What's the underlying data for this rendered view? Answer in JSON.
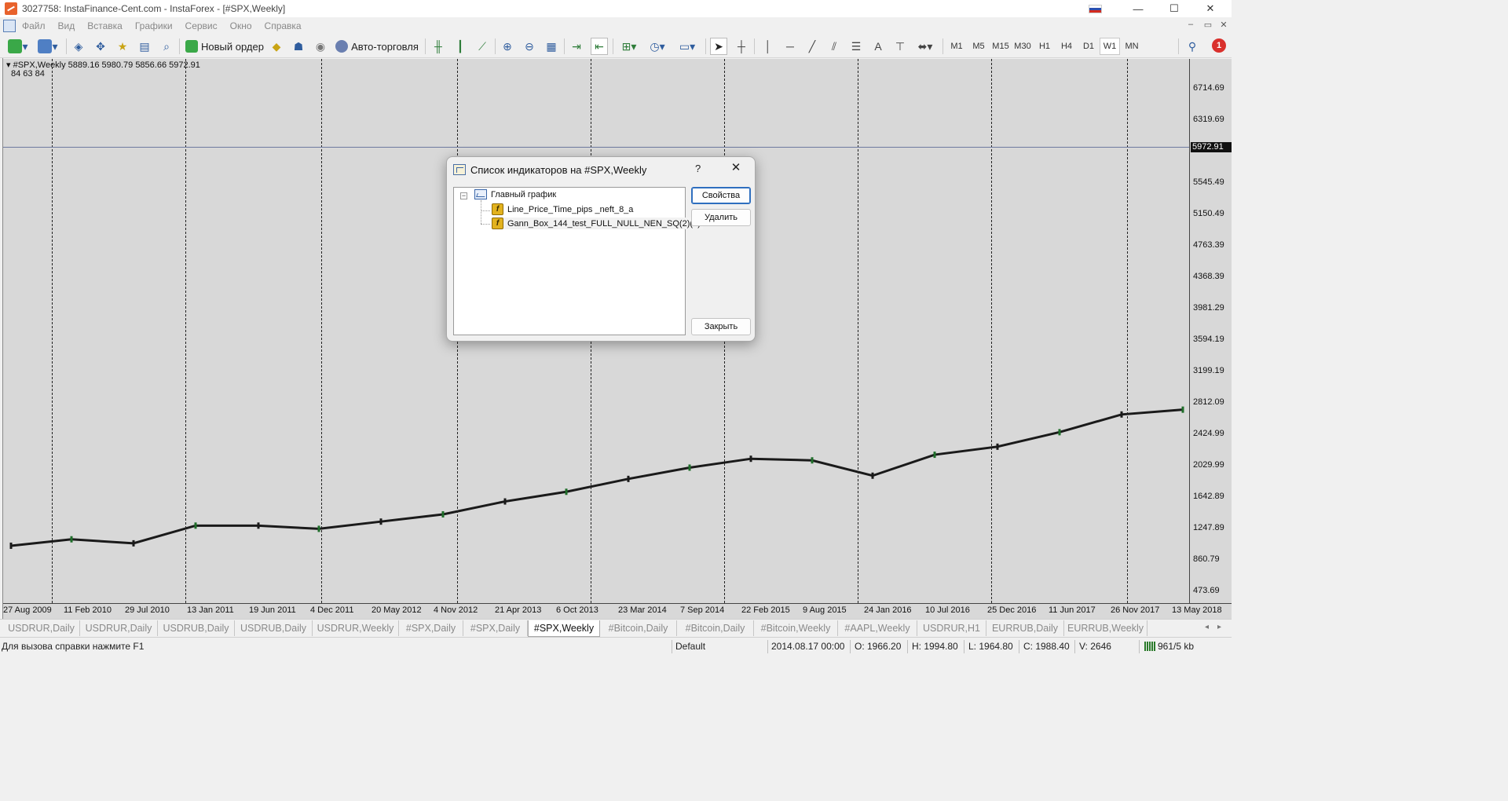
{
  "window": {
    "title": "3027758: InstaFinance-Cent.com - InstaForex - [#SPX,Weekly]",
    "minimize_icon": "—",
    "maximize_icon": "☐",
    "close_icon": "✕"
  },
  "menu": [
    "Файл",
    "Вид",
    "Вставка",
    "Графики",
    "Сервис",
    "Окно",
    "Справка"
  ],
  "toolbar": {
    "new_order_label": "Новый ордер",
    "auto_trading_label": "Авто-торговля",
    "timeframes": [
      "M1",
      "M5",
      "M15",
      "M30",
      "H1",
      "H4",
      "D1",
      "W1",
      "MN"
    ],
    "active_timeframe": "W1",
    "notification_count": "1"
  },
  "chart": {
    "info_line": "#SPX,Weekly  5889.16 5980.79 5856.66 5972.91",
    "info_values": "84   63   84",
    "current_price": "5972.91",
    "price_labels": [
      "6714.69",
      "6319.69",
      "5545.49",
      "5150.49",
      "4763.39",
      "4368.39",
      "3981.29",
      "3594.19",
      "3199.19",
      "2812.09",
      "2424.99",
      "2029.99",
      "1642.89",
      "1247.89",
      "860.79",
      "473.69"
    ],
    "time_labels": [
      "27 Aug 2009",
      "11 Feb 2010",
      "29 Jul 2010",
      "13 Jan 2011",
      "19 Jun 2011",
      "4 Dec 2011",
      "20 May 2012",
      "4 Nov 2012",
      "21 Apr 2013",
      "6 Oct 2013",
      "23 Mar 2014",
      "7 Sep 2014",
      "22 Feb 2015",
      "9 Aug 2015",
      "24 Jan 2016",
      "10 Jul 2016",
      "25 Dec 2016",
      "11 Jun 2017",
      "26 Nov 2017",
      "13 May 2018"
    ]
  },
  "chart_data": {
    "type": "line",
    "title": "#SPX,Weekly",
    "x": [
      "27 Aug 2009",
      "11 Feb 2010",
      "29 Jul 2010",
      "13 Jan 2011",
      "19 Jun 2011",
      "4 Dec 2011",
      "20 May 2012",
      "4 Nov 2012",
      "21 Apr 2013",
      "6 Oct 2013",
      "23 Mar 2014",
      "7 Sep 2014",
      "22 Feb 2015",
      "9 Aug 2015",
      "24 Jan 2016",
      "10 Jul 2016",
      "25 Dec 2016",
      "11 Jun 2017",
      "26 Nov 2017",
      "13 May 2018"
    ],
    "series": [
      {
        "values": [
          1030,
          1110,
          1060,
          1280,
          1280,
          1240,
          1330,
          1420,
          1580,
          1700,
          1860,
          2000,
          2110,
          2090,
          1900,
          2160,
          2260,
          2440,
          2660,
          2720
        ]
      }
    ],
    "ylim": [
      473.69,
      6714.69
    ],
    "grid": false,
    "current_price": 5972.91
  },
  "dialog": {
    "title": "Список индикаторов на #SPX,Weekly",
    "help": "?",
    "close": "✕",
    "tree_root": "Главный график",
    "indicators": [
      "Line_Price_Time_pips _neft_8_a",
      "Gann_Box_144_test_FULL_NULL_NEN_SQ(2)(8)"
    ],
    "btn_properties": "Свойства",
    "btn_delete": "Удалить",
    "btn_close": "Закрыть"
  },
  "tabs": [
    "USDRUR,Daily",
    "USDRUR,Daily",
    "USDRUB,Daily",
    "USDRUB,Daily",
    "USDRUR,Weekly",
    "#SPX,Daily",
    "#SPX,Daily",
    "#SPX,Weekly",
    "#Bitcoin,Daily",
    "#Bitcoin,Daily",
    "#Bitcoin,Weekly",
    "#AAPL,Weekly",
    "USDRUR,H1",
    "EURRUB,Daily",
    "EURRUB,Weekly"
  ],
  "active_tab_index": 7,
  "status": {
    "help": "Для вызова справки нажмите F1",
    "profile": "Default",
    "datetime": "2014.08.17 00:00",
    "open": "O: 1966.20",
    "high": "H: 1994.80",
    "low": "L: 1964.80",
    "close": "C: 1988.40",
    "volume": "V: 2646",
    "traffic": "961/5 kb"
  }
}
